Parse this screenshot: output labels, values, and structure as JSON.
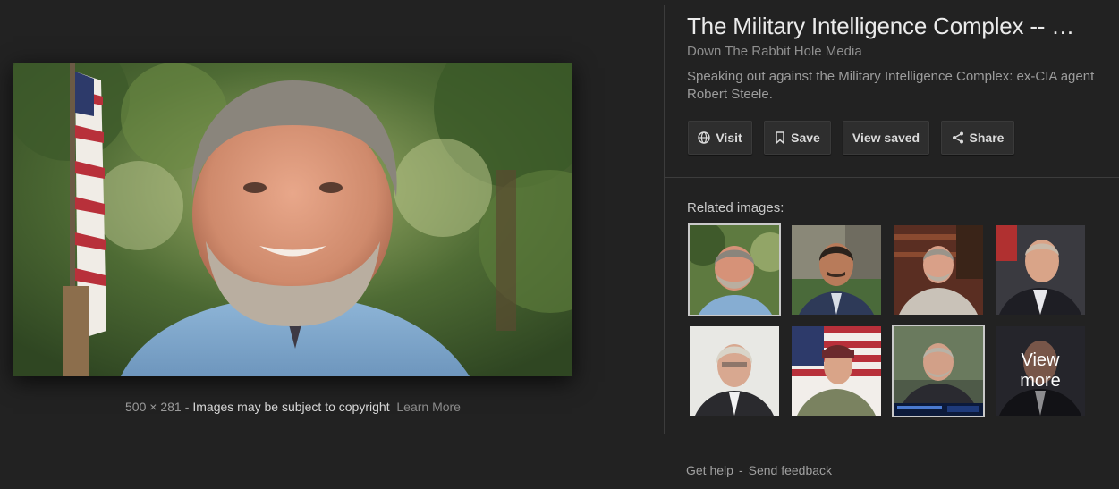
{
  "preview": {
    "dimensions": "500 × 281",
    "dash": "-",
    "copyright_text": "Images may be subject to copyright",
    "learn_more": "Learn More"
  },
  "info": {
    "title": "The Military Intelligence Complex -- …",
    "source": "Down The Rabbit Hole Media",
    "description": "Speaking out against the Military Intelligence Complex: ex-CIA agent Robert Steele."
  },
  "actions": {
    "visit": "Visit",
    "save": "Save",
    "view_saved": "View saved",
    "share": "Share"
  },
  "related": {
    "label": "Related images:",
    "view_more": "View\nmore"
  },
  "footer": {
    "get_help": "Get help",
    "dash": "-",
    "send_feedback": "Send feedback"
  },
  "colors": {
    "background": "#222222",
    "button_bg": "#2e2e2e",
    "title": "#ebebeb",
    "muted": "#8f8f8f"
  }
}
